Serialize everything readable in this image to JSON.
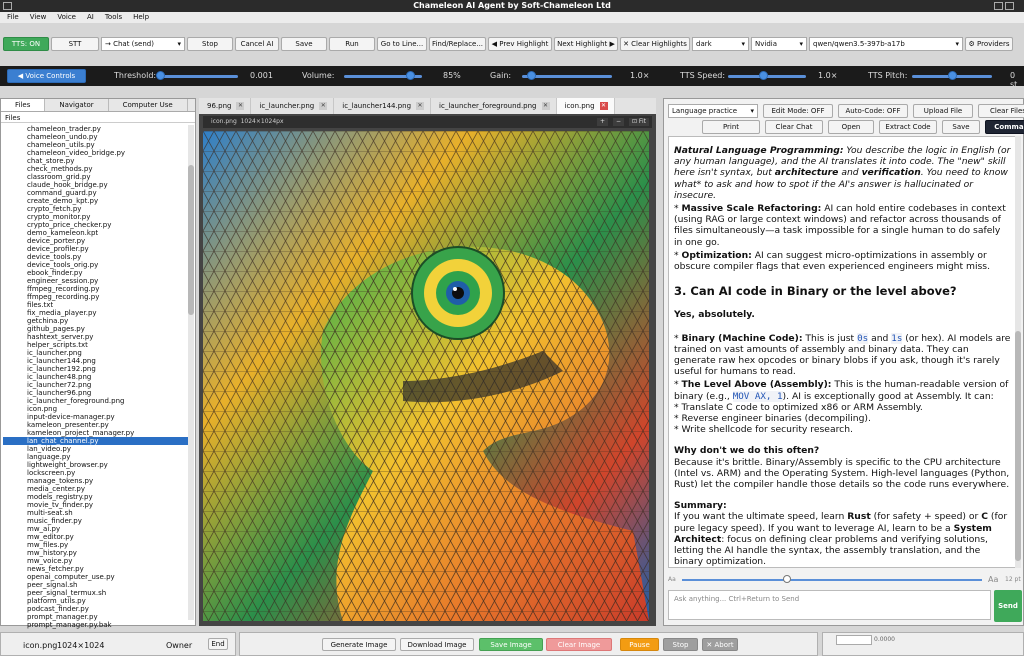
{
  "window": {
    "title": "Chameleon AI Agent by Soft-Chameleon Ltd"
  },
  "menu": [
    "File",
    "View",
    "Voice",
    "AI",
    "Tools",
    "Help"
  ],
  "toolbar": {
    "tts_btn": "TTS: ON",
    "stt_btn": "STT",
    "chat_mode": "→ Chat (send)",
    "stop": "Stop",
    "cancel_ai": "Cancel AI",
    "save": "Save",
    "run": "Run",
    "goto_line": "Go to Line...",
    "find_replace": "Find/Replace...",
    "prev_highlight": "◀ Prev Highlight",
    "next_highlight": "Next Highlight ▶",
    "clear_highlights": "✕ Clear Highlights",
    "theme": "dark",
    "gpu": "Nvidia",
    "model": "qwen/qwen3.5-397b-a17b",
    "providers": "⚙ Providers"
  },
  "voice": {
    "toggle": "◀ Voice Controls",
    "threshold_label": "Threshold:",
    "threshold_value": "0.001",
    "threshold_level": 0.0,
    "volume_label": "Volume:",
    "volume_value": "85%",
    "volume_level": 0.85,
    "gain_label": "Gain:",
    "gain_value": "1.0×",
    "gain_level": 0.1,
    "tts_speed_label": "TTS Speed:",
    "tts_speed_value": "1.0×",
    "tts_speed_level": 0.45,
    "tts_pitch_label": "TTS Pitch:",
    "tts_pitch_value": "0 st",
    "tts_pitch_level": 0.5
  },
  "left": {
    "tabs": [
      "Files",
      "Navigator",
      "Computer Use"
    ],
    "header": "Files",
    "selected_index": 39,
    "files": [
      "chameleon_trader.py",
      "chameleon_undo.py",
      "chameleon_utils.py",
      "chameleon_video_bridge.py",
      "chat_store.py",
      "check_methods.py",
      "classroom_grid.py",
      "claude_hook_bridge.py",
      "command_guard.py",
      "create_demo_kpt.py",
      "crypto_fetch.py",
      "crypto_monitor.py",
      "crypto_price_checker.py",
      "demo_kameleon.kpt",
      "device_porter.py",
      "device_profiler.py",
      "device_tools.py",
      "device_tools_orig.py",
      "ebook_finder.py",
      "engineer_session.py",
      "ffmpeg_recording.py",
      "ffmpeg_recording.py",
      "files.txt",
      "fix_media_player.py",
      "getchina.py",
      "github_pages.py",
      "hashtext_server.py",
      "helper_scripts.txt",
      "ic_launcher.png",
      "ic_launcher144.png",
      "ic_launcher192.png",
      "ic_launcher48.png",
      "ic_launcher72.png",
      "ic_launcher96.png",
      "ic_launcher_foreground.png",
      "icon.png",
      "input-device-manager.py",
      "kameleon_presenter.py",
      "kameleon_project_manager.py",
      "lan_chat_channel.py",
      "lan_video.py",
      "language.py",
      "lightweight_browser.py",
      "lockscreen.py",
      "manage_tokens.py",
      "media_center.py",
      "models_registry.py",
      "movie_tv_finder.py",
      "multi-seat.sh",
      "music_finder.py",
      "mw_ai.py",
      "mw_editor.py",
      "mw_files.py",
      "mw_history.py",
      "mw_voice.py",
      "news_fetcher.py",
      "openai_computer_use.py",
      "peer_signal.sh",
      "peer_signal_termux.sh",
      "platform_utils.py",
      "podcast_finder.py",
      "prompt_manager.py",
      "prompt_manager.py.bak"
    ]
  },
  "center": {
    "tabs": [
      "96.png",
      "ic_launcher.png",
      "ic_launcher144.png",
      "ic_launcher_foreground.png",
      "icon.png"
    ],
    "active_tab": "icon.png",
    "image_name": "icon.png",
    "image_size": "1024×1024px",
    "zoom_fit": "⊡ Fit",
    "zoom_in": "+",
    "zoom_out": "−"
  },
  "right": {
    "mode": "Language practice",
    "edit_mode": "Edit Mode: OFF",
    "auto_code": "Auto-Code: OFF",
    "upload": "Upload File",
    "clear_files": "Clear Files",
    "print": "Print",
    "clear_chat": "Clear Chat",
    "open": "Open",
    "extract_code": "Extract Code",
    "save": "Save",
    "commands": "Commands",
    "chat": {
      "p1_b": "Natural Language Programming:",
      "p1": " You describe the logic in English (or any human language), and the AI translates it into code. The \"new\" skill here isn't syntax, but ",
      "p1_b2": "architecture",
      "p1_mid": " and ",
      "p1_b3": "verification",
      "p1_end": ". You need to know what* to ask and how to spot if the AI's answer is hallucinated or insecure.",
      "p2_b": "Massive Scale Refactoring:",
      "p2": " AI can hold entire codebases in context (using RAG or large context windows) and refactor across thousands of files simultaneously—a task impossible for a single human to do safely in one go.",
      "p3_b": "Optimization:",
      "p3": " AI can suggest micro-optimizations in assembly or obscure compiler flags that even experienced engineers might miss.",
      "h3": "3. Can AI code in Binary or the level above?",
      "yes": "Yes, absolutely.",
      "p4_b": "Binary (Machine Code):",
      "p4_a": " This is just ",
      "p4_c1": "0s",
      "p4_and": " and ",
      "p4_c2": "1s",
      "p4_end": " (or hex). AI models are trained on vast amounts of assembly and binary data. They can generate raw hex opcodes or binary blobs if you ask, though it's rarely useful for humans to read.",
      "p5_b": "The Level Above (Assembly):",
      "p5_a": " This is the human-readable version of binary (e.g., ",
      "p5_code": "MOV AX, 1",
      "p5_end": "). AI is exceptionally good at Assembly. It can:",
      "l1": "* Translate C code to optimized x86 or ARM Assembly.",
      "l2": "* Reverse engineer binaries (decompiling).",
      "l3": "* Write shellcode for security research.",
      "why_h": "Why don't we do this often?",
      "why": "Because it's brittle. Binary/Assembly is specific to the CPU architecture (Intel vs. ARM) and the Operating System. High-level languages (Python, Rust) let the compiler handle those details so the code runs everywhere.",
      "sum_h": "Summary:",
      "sum_a": "If you want the ultimate speed, learn ",
      "sum_rust": "Rust",
      "sum_b": " (for safety + speed) or ",
      "sum_c": "C",
      "sum_c2": " (for pure legacy speed). If you want to leverage AI, learn to be a ",
      "sum_arch": "System Architect",
      "sum_end": ": focus on defining clear problems and verifying solutions, letting the AI handle the syntax, the assembly translation, and the binary optimization."
    },
    "font_small": "Aa",
    "font_large": "Aa",
    "font_size": "12 pt",
    "font_level": 0.35,
    "input_placeholder": "Ask anything... Ctrl+Return to Send",
    "send": "Send"
  },
  "bottom": {
    "file_name": "icon.png",
    "file_size": "1024×1024",
    "owner": "Owner",
    "end": "End",
    "generate": "Generate Image",
    "download": "Download Image",
    "save_image": "Save Image",
    "clear_image": "Clear Image",
    "pause": "Pause",
    "stop": "Stop",
    "abort": "✕ Abort",
    "coord": "0.0000"
  },
  "colors": {
    "green": "#3fa95a",
    "blue": "#2a6fc4",
    "orange": "#f39c12",
    "red": "#e57373"
  }
}
